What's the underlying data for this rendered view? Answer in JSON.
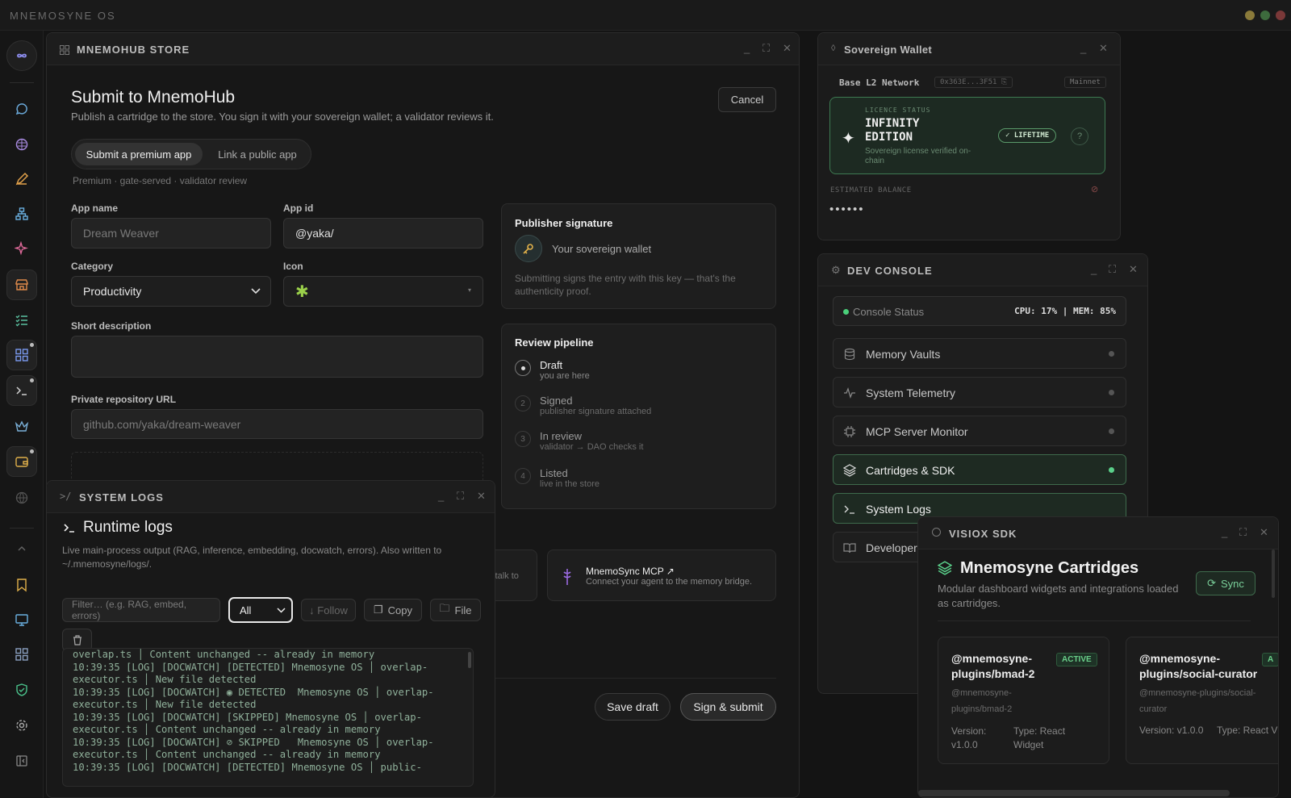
{
  "os": {
    "title": "MNEMOSYNE OS",
    "traffic_colors": [
      "#8a7a3a",
      "#3a6a3a",
      "#7a3a3a"
    ]
  },
  "sidebar": {
    "items": [
      "infinity-icon",
      "chat-icon",
      "brain-icon",
      "pen-icon",
      "network-icon",
      "sparkle-icon",
      "store-icon",
      "checklist-icon",
      "grid-icon",
      "terminal-icon",
      "crown-icon",
      "wallet-icon",
      "globe-icon",
      "chevron-up-icon",
      "bookmark-icon",
      "monitor-icon",
      "apps-icon",
      "shield-icon",
      "gear-icon",
      "collapse-icon"
    ]
  },
  "store": {
    "window_title": "MNEMOHUB STORE",
    "heading": "Submit to MnemoHub",
    "subtitle": "Publish a cartridge to the store. You sign it with your sovereign wallet; a validator reviews it.",
    "cancel": "Cancel",
    "tabs": [
      "Submit a premium app",
      "Link a public app"
    ],
    "mode_note": "Premium · gate-served · validator review",
    "fields": {
      "app_name_label": "App name",
      "app_name_placeholder": "Dream Weaver",
      "app_id_label": "App id",
      "app_id_value": "@yaka/",
      "category_label": "Category",
      "category_value": "Productivity",
      "icon_label": "Icon",
      "icon_value": "✱",
      "short_desc_label": "Short description",
      "repo_label": "Private repository URL",
      "repo_placeholder": "github.com/yaka/dream-weaver"
    },
    "publisher": {
      "title": "Publisher signature",
      "wallet": "Your sovereign wallet",
      "note": "Submitting signs the entry with this key — that's the authenticity proof."
    },
    "pipeline": {
      "title": "Review pipeline",
      "steps": [
        {
          "n": "",
          "title": "Draft",
          "sub": "you are here"
        },
        {
          "n": "2",
          "title": "Signed",
          "sub": "publisher signature attached"
        },
        {
          "n": "3",
          "title": "In review",
          "sub": "validator → DAO checks it"
        },
        {
          "n": "4",
          "title": "Listed",
          "sub": "live in the store"
        }
      ]
    },
    "mcp": {
      "title": "MnemoSync MCP ↗",
      "sub": "Connect your agent to the memory bridge."
    },
    "partial_card_text": "s talk to",
    "save_draft": "Save draft",
    "sign_submit": "Sign & submit"
  },
  "wallet": {
    "window_title": "Sovereign Wallet",
    "network": "Base L2 Network",
    "address": "0x363E...3F51 ⎘",
    "chain": "Mainnet",
    "licence_label": "LICENCE STATUS",
    "edition_line1": "INFINITY",
    "edition_line2": "EDITION",
    "licence_note": "Sovereign license verified on-chain",
    "lifetime": "✓ LIFETIME",
    "help": "?",
    "balance_label": "ESTIMATED BALANCE",
    "balance_masked": "••••••"
  },
  "dev": {
    "window_title": "DEV CONSOLE",
    "status_label": "Console Status",
    "status_value": "CPU: 17% | MEM: 85%",
    "items": [
      {
        "label": "Memory Vaults",
        "icon": "database-icon",
        "active": false
      },
      {
        "label": "System Telemetry",
        "icon": "pulse-icon",
        "active": false
      },
      {
        "label": "MCP Server Monitor",
        "icon": "chip-icon",
        "active": false
      },
      {
        "label": "Cartridges & SDK",
        "icon": "layers-icon",
        "active": true
      },
      {
        "label": "System Logs",
        "icon": "terminal-icon",
        "active": false
      },
      {
        "label": "Developer",
        "icon": "book-icon",
        "active": false
      }
    ]
  },
  "logs": {
    "window_title": "SYSTEM LOGS",
    "heading": "Runtime logs",
    "desc": "Live main-process output (RAG, inference, embedding, docwatch, errors). Also written to ~/.mnemosyne/logs/.",
    "filter_placeholder": "Filter… (e.g. RAG, embed, errors)",
    "level_value": "All",
    "follow": "↓ Follow",
    "copy": "Copy",
    "file": "File",
    "lines": [
      "overlap.ts │ Content unchanged -- already in memory",
      "10:39:35 [LOG] [DOCWATCH] [DETECTED] Mnemosyne OS │ overlap-",
      "executor.ts │ New file detected",
      "10:39:35 [LOG] [DOCWATCH] ◉ DETECTED  Mnemosyne OS │ overlap-",
      "executor.ts │ New file detected",
      "10:39:35 [LOG] [DOCWATCH] [SKIPPED] Mnemosyne OS │ overlap-",
      "executor.ts │ Content unchanged -- already in memory",
      "10:39:35 [LOG] [DOCWATCH] ⊘ SKIPPED   Mnemosyne OS │ overlap-",
      "executor.ts │ Content unchanged -- already in memory",
      "10:39:35 [LOG] [DOCWATCH] [DETECTED] Mnemosyne OS │ public-"
    ]
  },
  "visiox": {
    "window_title": "VISIOX SDK",
    "heading": "Mnemosyne Cartridges",
    "desc": "Modular dashboard widgets and integrations loaded as cartridges.",
    "sync": "Sync",
    "cards": [
      {
        "name": "@mnemosyne-plugins/bmad-2",
        "badge": "ACTIVE",
        "pkg": "@mnemosyne-plugins/bmad-2",
        "version": "Version: v1.0.0",
        "type": "Type: React Widget"
      },
      {
        "name": "@mnemosyne-plugins/social-curator",
        "badge": "A",
        "pkg": "@mnemosyne-plugins/social-curator",
        "version": "Version: v1.0.0",
        "type": "Type: React V"
      }
    ]
  }
}
